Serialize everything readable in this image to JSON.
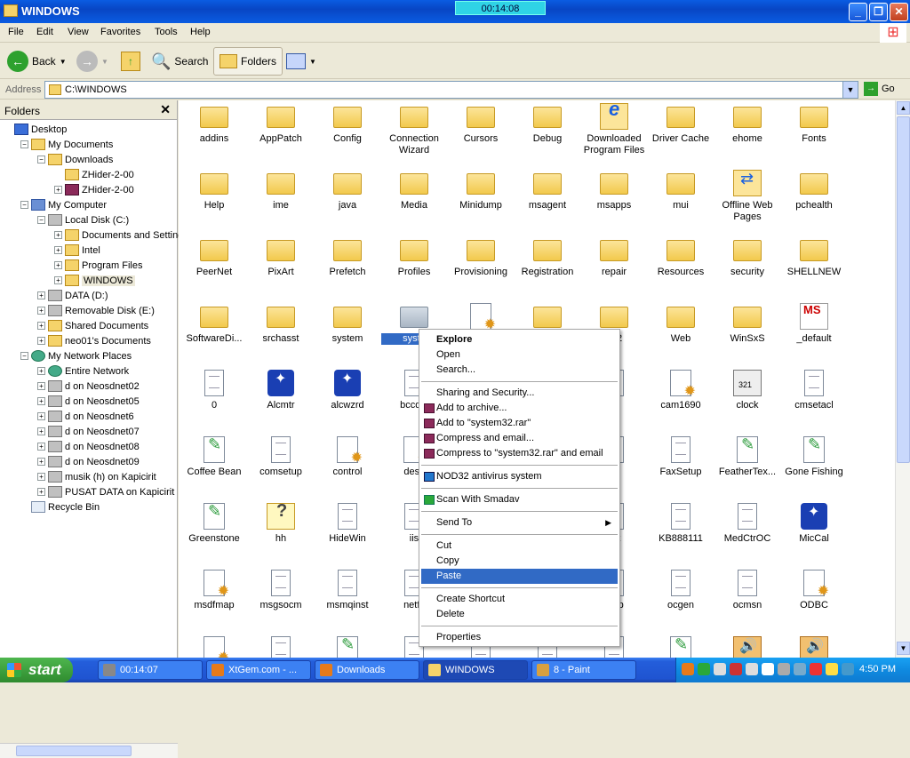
{
  "window": {
    "title": "WINDOWS",
    "timer": "00:14:08"
  },
  "menu": [
    "File",
    "Edit",
    "View",
    "Favorites",
    "Tools",
    "Help"
  ],
  "toolbar": {
    "back": "Back",
    "search": "Search",
    "folders": "Folders"
  },
  "address": {
    "label": "Address",
    "value": "C:\\WINDOWS",
    "go": "Go"
  },
  "folders_panel": {
    "title": "Folders",
    "close": "✕",
    "tree": [
      {
        "label": "Desktop",
        "depth": 0,
        "pm": "",
        "icon": "desk"
      },
      {
        "label": "My Documents",
        "depth": 1,
        "pm": "−",
        "icon": "folder"
      },
      {
        "label": "Downloads",
        "depth": 2,
        "pm": "−",
        "icon": "folder"
      },
      {
        "label": "ZHider-2-00",
        "depth": 3,
        "pm": "",
        "icon": "folder"
      },
      {
        "label": "ZHider-2-00",
        "depth": 3,
        "pm": "+",
        "icon": "rar"
      },
      {
        "label": "My Computer",
        "depth": 1,
        "pm": "−",
        "icon": "pc"
      },
      {
        "label": "Local Disk (C:)",
        "depth": 2,
        "pm": "−",
        "icon": "drive"
      },
      {
        "label": "Documents and Settings",
        "depth": 3,
        "pm": "+",
        "icon": "folder"
      },
      {
        "label": "Intel",
        "depth": 3,
        "pm": "+",
        "icon": "folder"
      },
      {
        "label": "Program Files",
        "depth": 3,
        "pm": "+",
        "icon": "folder"
      },
      {
        "label": "WINDOWS",
        "depth": 3,
        "pm": "+",
        "icon": "folder",
        "selected": true
      },
      {
        "label": "DATA (D:)",
        "depth": 2,
        "pm": "+",
        "icon": "drive"
      },
      {
        "label": "Removable Disk (E:)",
        "depth": 2,
        "pm": "+",
        "icon": "drive"
      },
      {
        "label": "Shared Documents",
        "depth": 2,
        "pm": "+",
        "icon": "folder"
      },
      {
        "label": "neo01's Documents",
        "depth": 2,
        "pm": "+",
        "icon": "folder"
      },
      {
        "label": "My Network Places",
        "depth": 1,
        "pm": "−",
        "icon": "net"
      },
      {
        "label": "Entire Network",
        "depth": 2,
        "pm": "+",
        "icon": "net"
      },
      {
        "label": "d on Neosdnet02",
        "depth": 2,
        "pm": "+",
        "icon": "drive"
      },
      {
        "label": "d on Neosdnet05",
        "depth": 2,
        "pm": "+",
        "icon": "drive"
      },
      {
        "label": "d on Neosdnet6",
        "depth": 2,
        "pm": "+",
        "icon": "drive"
      },
      {
        "label": "d on Neosdnet07",
        "depth": 2,
        "pm": "+",
        "icon": "drive"
      },
      {
        "label": "d on Neosdnet08",
        "depth": 2,
        "pm": "+",
        "icon": "drive"
      },
      {
        "label": "d on Neosdnet09",
        "depth": 2,
        "pm": "+",
        "icon": "drive"
      },
      {
        "label": "musik (h) on Kapicirit",
        "depth": 2,
        "pm": "+",
        "icon": "drive"
      },
      {
        "label": "PUSAT DATA on Kapicirit",
        "depth": 2,
        "pm": "+",
        "icon": "drive"
      },
      {
        "label": "Recycle Bin",
        "depth": 1,
        "pm": "",
        "icon": "bin"
      }
    ]
  },
  "files": [
    [
      "addins",
      "folder"
    ],
    [
      "AppPatch",
      "folder"
    ],
    [
      "Config",
      "folder"
    ],
    [
      "Connection Wizard",
      "folder"
    ],
    [
      "Cursors",
      "folder"
    ],
    [
      "Debug",
      "folder"
    ],
    [
      "Downloaded Program Files",
      "ie"
    ],
    [
      "Driver Cache",
      "folder"
    ],
    [
      "ehome",
      "folder"
    ],
    [
      "Fonts",
      "folder"
    ],
    [
      "Help",
      "folder"
    ],
    [
      "ime",
      "folder"
    ],
    [
      "java",
      "folder"
    ],
    [
      "Media",
      "folder"
    ],
    [
      "Minidump",
      "folder"
    ],
    [
      "msagent",
      "folder"
    ],
    [
      "msapps",
      "folder"
    ],
    [
      "mui",
      "folder"
    ],
    [
      "Offline Web Pages",
      "offline"
    ],
    [
      "pchealth",
      "folder"
    ],
    [
      "PeerNet",
      "folder"
    ],
    [
      "PixArt",
      "folder"
    ],
    [
      "Prefetch",
      "folder"
    ],
    [
      "Profiles",
      "folder"
    ],
    [
      "Provisioning",
      "folder"
    ],
    [
      "Registration",
      "folder"
    ],
    [
      "repair",
      "folder"
    ],
    [
      "Resources",
      "folder"
    ],
    [
      "security",
      "folder"
    ],
    [
      "SHELLNEW",
      "folder"
    ],
    [
      "SoftwareDi...",
      "folder"
    ],
    [
      "srchasst",
      "folder"
    ],
    [
      "system",
      "folder"
    ],
    [
      "syste",
      "sysfolder"
    ],
    [
      "",
      "gear"
    ],
    [
      "",
      "folder"
    ],
    [
      "_32",
      "folder"
    ],
    [
      "Web",
      "folder"
    ],
    [
      "WinSxS",
      "folder"
    ],
    [
      "_default",
      "ms"
    ],
    [
      "0",
      "doc"
    ],
    [
      "Alcmtr",
      "app"
    ],
    [
      "alcwzrd",
      "app"
    ],
    [
      "bccdia",
      "doc"
    ],
    [
      "",
      "doc"
    ],
    [
      "",
      "doc"
    ],
    [
      "tet",
      "doc"
    ],
    [
      "cam1690",
      "gear"
    ],
    [
      "clock",
      "clock"
    ],
    [
      "cmsetacl",
      "doc"
    ],
    [
      "Coffee Bean",
      "pen"
    ],
    [
      "comsetup",
      "doc"
    ],
    [
      "control",
      "gear"
    ],
    [
      "desk",
      "gear"
    ],
    [
      "",
      "doc"
    ],
    [
      "",
      "doc"
    ],
    [
      "rer",
      "doc"
    ],
    [
      "FaxSetup",
      "doc"
    ],
    [
      "FeatherTex...",
      "pen"
    ],
    [
      "Gone Fishing",
      "pen"
    ],
    [
      "Greenstone",
      "pen"
    ],
    [
      "hh",
      "help"
    ],
    [
      "HideWin",
      "doc"
    ],
    [
      "iis",
      "doc"
    ],
    [
      "",
      "doc"
    ],
    [
      "",
      "doc"
    ],
    [
      "nst",
      "doc"
    ],
    [
      "KB888111",
      "doc"
    ],
    [
      "MedCtrOC",
      "doc"
    ],
    [
      "MicCal",
      "app"
    ],
    [
      "msdfmap",
      "gear"
    ],
    [
      "msgsocm",
      "doc"
    ],
    [
      "msmqinst",
      "doc"
    ],
    [
      "netfx",
      "doc"
    ],
    [
      "",
      "doc"
    ],
    [
      "",
      "doc"
    ],
    [
      "etup",
      "doc"
    ],
    [
      "ocgen",
      "doc"
    ],
    [
      "ocmsn",
      "doc"
    ],
    [
      "ODBC",
      "gear"
    ],
    [
      "",
      "gear"
    ],
    [
      "",
      "doc"
    ],
    [
      "",
      "pen"
    ],
    [
      "",
      "doc"
    ],
    [
      "",
      "doc"
    ],
    [
      "",
      "doc"
    ],
    [
      "",
      "doc"
    ],
    [
      "",
      "pen"
    ],
    [
      "",
      "audio"
    ],
    [
      "",
      "audio"
    ]
  ],
  "context_menu": {
    "items": [
      {
        "label": "Explore",
        "bold": true
      },
      {
        "label": "Open"
      },
      {
        "label": "Search..."
      },
      {
        "sep": true
      },
      {
        "label": "Sharing and Security..."
      },
      {
        "label": "Add to archive...",
        "icon": "rar"
      },
      {
        "label": "Add to \"system32.rar\"",
        "icon": "rar"
      },
      {
        "label": "Compress and email...",
        "icon": "rar"
      },
      {
        "label": "Compress to \"system32.rar\" and email",
        "icon": "rar"
      },
      {
        "sep": true
      },
      {
        "label": "NOD32 antivirus system",
        "icon": "nod"
      },
      {
        "sep": true
      },
      {
        "label": "Scan With Smadav",
        "icon": "sma"
      },
      {
        "sep": true
      },
      {
        "label": "Send To",
        "arrow": true
      },
      {
        "sep": true
      },
      {
        "label": "Cut"
      },
      {
        "label": "Copy"
      },
      {
        "label": "Paste",
        "highlight": true
      },
      {
        "sep": true
      },
      {
        "label": "Create Shortcut"
      },
      {
        "label": "Delete"
      },
      {
        "sep": true
      },
      {
        "label": "Properties"
      }
    ]
  },
  "taskbar": {
    "start": "start",
    "tasks": [
      {
        "label": "00:14:07",
        "color": "#888"
      },
      {
        "label": "XtGem.com - ...",
        "color": "#e67a1a"
      },
      {
        "label": "Downloads",
        "color": "#e67a1a"
      },
      {
        "label": "WINDOWS",
        "color": "#f5d36a",
        "active": true
      },
      {
        "label": "8 - Paint",
        "color": "#d8a040"
      }
    ],
    "clock": "4:50 PM"
  }
}
